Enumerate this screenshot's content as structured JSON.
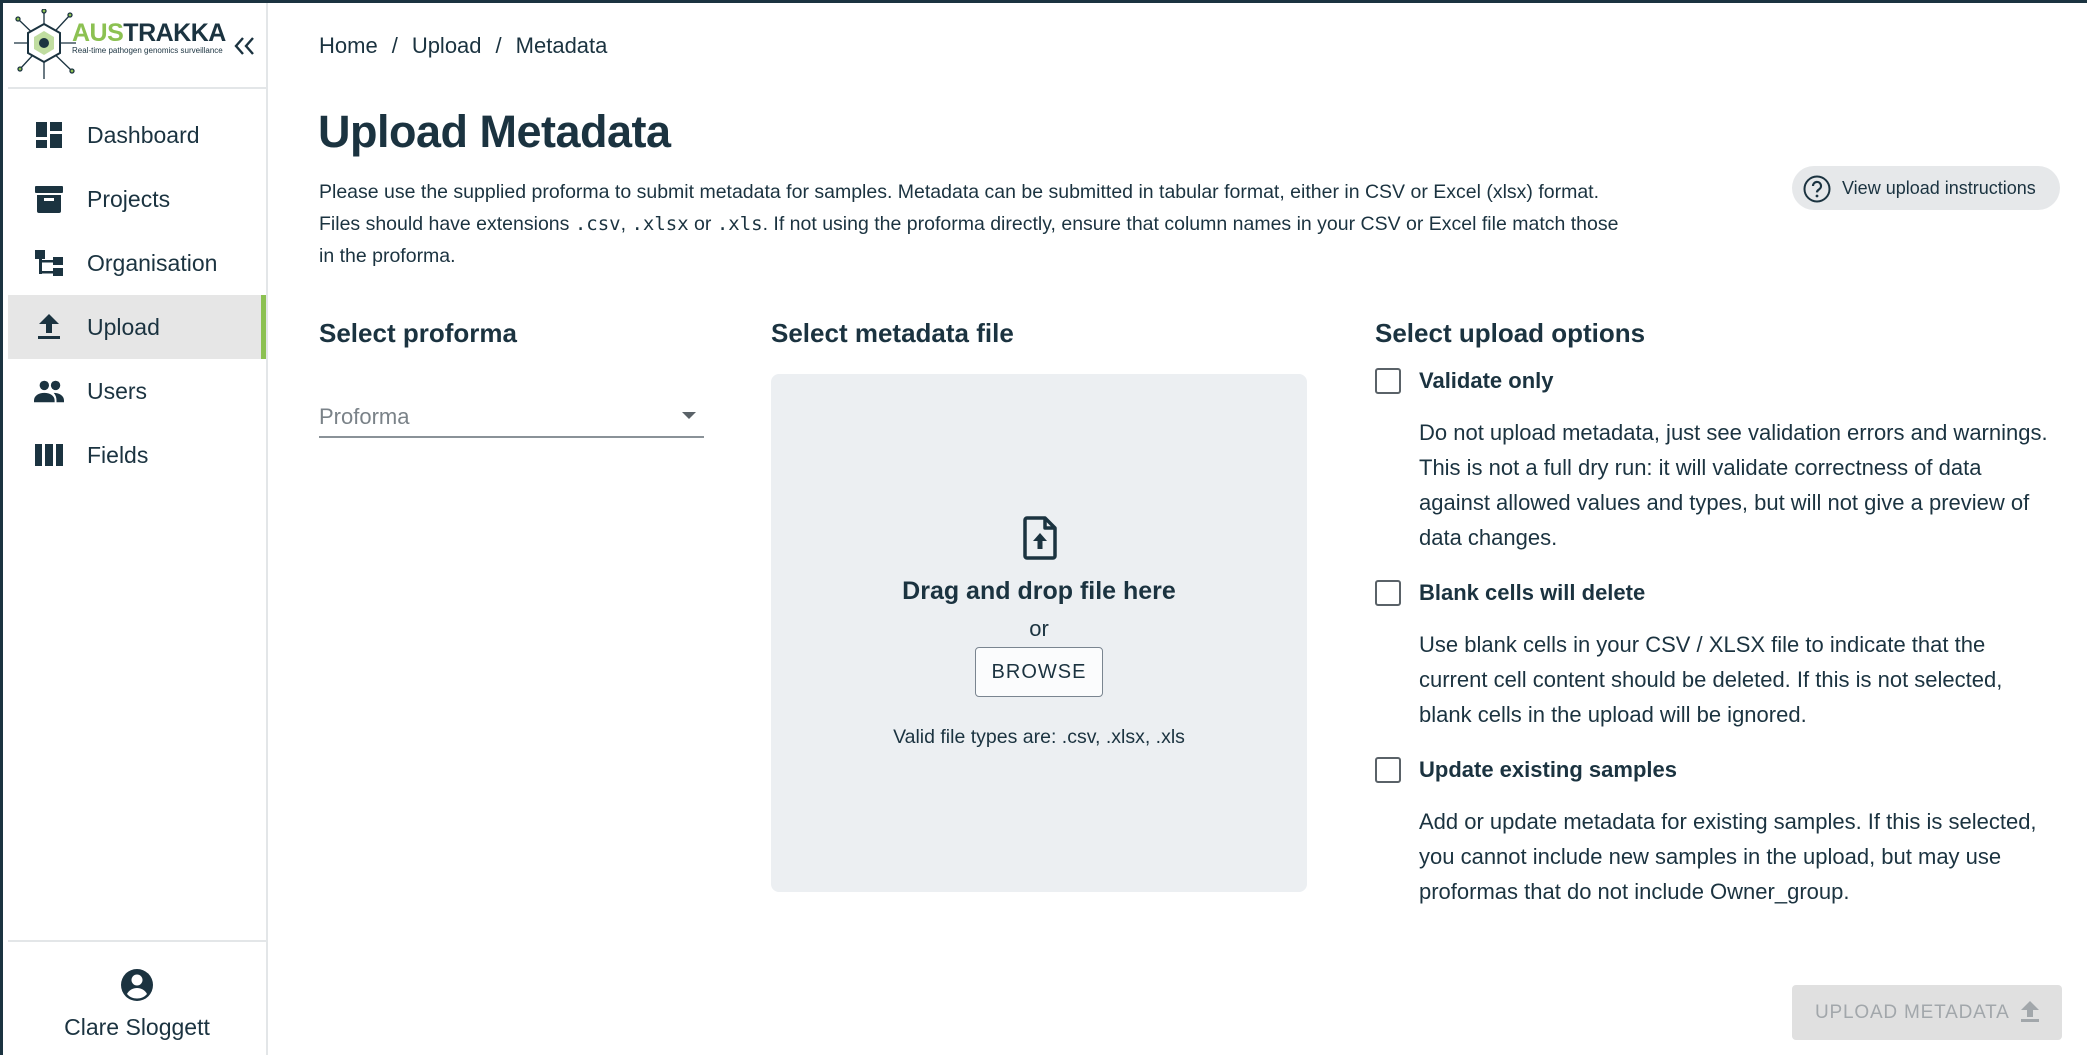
{
  "brand": {
    "title_part1": "AUS",
    "title_part2": "TRAKKA",
    "tagline": "Real-time pathogen genomics surveillance"
  },
  "sidebar": {
    "items": [
      {
        "label": "Dashboard",
        "icon": "dashboard-icon",
        "active": false
      },
      {
        "label": "Projects",
        "icon": "archive-box-icon",
        "active": false
      },
      {
        "label": "Organisation",
        "icon": "account-tree-icon",
        "active": false
      },
      {
        "label": "Upload",
        "icon": "upload-icon",
        "active": true
      },
      {
        "label": "Users",
        "icon": "people-icon",
        "active": false
      },
      {
        "label": "Fields",
        "icon": "view-columns-icon",
        "active": false
      }
    ],
    "user_name": "Clare Sloggett"
  },
  "breadcrumb": [
    "Home",
    "Upload",
    "Metadata"
  ],
  "breadcrumb_sep": "/",
  "page": {
    "title": "Upload Metadata",
    "intro_part1": "Please use the supplied proforma to submit metadata for samples. Metadata can be submitted in tabular format, either in CSV or Excel (xlsx) format. Files should have extensions ",
    "ext_csv": ".csv",
    "ext_sep1": ", ",
    "ext_xlsx": ".xlsx",
    "ext_or": " or ",
    "ext_xls": ".xls",
    "intro_part2": ". If not using the proforma directly, ensure that column names in your CSV or Excel file match those in the proforma.",
    "instructions_button": "View upload instructions"
  },
  "proforma": {
    "heading": "Select proforma",
    "placeholder": "Proforma"
  },
  "file": {
    "heading": "Select metadata file",
    "drop_text": "Drag and drop file here",
    "or_text": "or",
    "browse_label": "BROWSE",
    "valid_types": "Valid file types are: .csv, .xlsx, .xls"
  },
  "options": {
    "heading": "Select upload options",
    "items": [
      {
        "label": "Validate only",
        "checked": false,
        "description": "Do not upload metadata, just see validation errors and warnings. This is not a full dry run: it will validate correctness of data against allowed values and types, but will not give a preview of data changes."
      },
      {
        "label": "Blank cells will delete",
        "checked": false,
        "description": "Use blank cells in your CSV / XLSX file to indicate that the current cell content should be deleted. If this is not selected, blank cells in the upload will be ignored."
      },
      {
        "label": "Update existing samples",
        "checked": false,
        "description": "Add or update metadata for existing samples. If this is selected, you cannot include new samples in the upload, but may use proformas that do not include Owner_group."
      }
    ]
  },
  "submit": {
    "label": "UPLOAD METADATA",
    "enabled": false
  },
  "colors": {
    "brand_dark": "#1b3340",
    "brand_green": "#8cc152",
    "active_bg": "#e6e6e6",
    "dropzone_bg": "#eceff2",
    "disabled_bg": "#e0e0e0"
  }
}
